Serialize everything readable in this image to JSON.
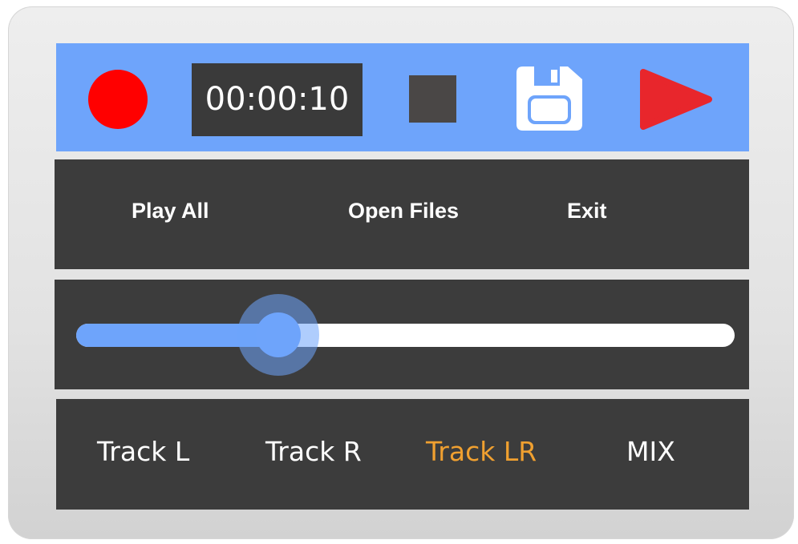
{
  "colors": {
    "toolbar_bg": "#6ea4fb",
    "panel_bg": "#3c3c3c",
    "record": "#ff0000",
    "stop": "#4a4746",
    "play": "#e8262c",
    "accent_active": "#f0a030",
    "save_icon": "#ffffff"
  },
  "icons": {
    "record": "record-circle-icon",
    "stop": "stop-square-icon",
    "save": "floppy-disk-icon",
    "play": "play-triangle-icon"
  },
  "toolbar": {
    "timer": "00:00:10"
  },
  "menu": {
    "items": [
      {
        "label": "Play All"
      },
      {
        "label": "Open Files"
      },
      {
        "label": "Exit"
      }
    ]
  },
  "slider": {
    "progress": 0.21
  },
  "tracks": {
    "items": [
      {
        "label": "Track L",
        "active": false
      },
      {
        "label": "Track R",
        "active": false
      },
      {
        "label": "Track LR",
        "active": true
      },
      {
        "label": "MIX",
        "active": false
      }
    ]
  }
}
